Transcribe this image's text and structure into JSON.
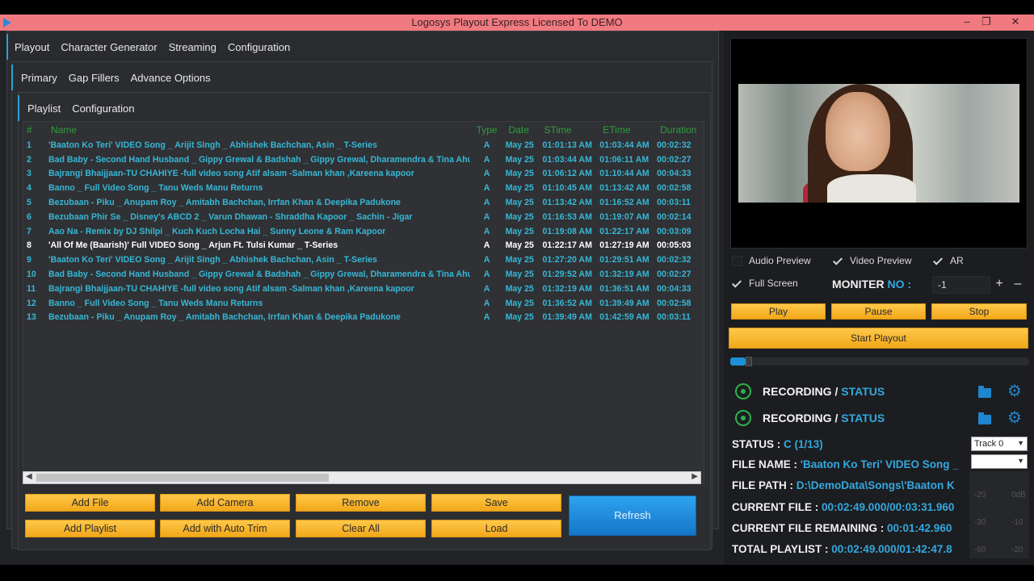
{
  "window": {
    "title": "Logosys Playout Express Licensed To DEMO",
    "controls": [
      "–",
      "❐",
      "✕"
    ]
  },
  "tabs_main": [
    "Playout",
    "Character Generator",
    "Streaming",
    "Configuration"
  ],
  "tabs_sub": [
    "Primary",
    "Gap Fillers",
    "Advance Options"
  ],
  "tabs_playlist": [
    "Playlist",
    "Configuration"
  ],
  "playlist": {
    "columns": [
      "#",
      "Name",
      "Type",
      "Date",
      "STime",
      "ETime",
      "Duration"
    ],
    "current_index": 8,
    "rows": [
      {
        "num": "1",
        "name": "'Baaton Ko Teri' VIDEO Song _ Arijit Singh _ Abhishek Bachchan, Asin _ T-Series",
        "type": "A",
        "date": "May 25",
        "stime": "01:01:13 AM",
        "etime": "01:03:44 AM",
        "duration": "00:02:32"
      },
      {
        "num": "2",
        "name": "Bad Baby - Second Hand Husband _ Gippy Grewal & Badshah _ Gippy Grewal, Dharamendra & Tina Ahuja",
        "type": "A",
        "date": "May 25",
        "stime": "01:03:44 AM",
        "etime": "01:06:11 AM",
        "duration": "00:02:27"
      },
      {
        "num": "3",
        "name": "Bajrangi Bhaijjaan-TU CHAHIYE -full video song Atif alsam -Salman khan ,Kareena kapoor",
        "type": "A",
        "date": "May 25",
        "stime": "01:06:12 AM",
        "etime": "01:10:44 AM",
        "duration": "00:04:33"
      },
      {
        "num": "4",
        "name": "Banno _ Full Video Song _ Tanu Weds Manu Returns",
        "type": "A",
        "date": "May 25",
        "stime": "01:10:45 AM",
        "etime": "01:13:42 AM",
        "duration": "00:02:58"
      },
      {
        "num": "5",
        "name": "Bezubaan - Piku _ Anupam Roy _ Amitabh Bachchan, Irrfan Khan & Deepika Padukone",
        "type": "A",
        "date": "May 25",
        "stime": "01:13:42 AM",
        "etime": "01:16:52 AM",
        "duration": "00:03:11"
      },
      {
        "num": "6",
        "name": "Bezubaan Phir Se _ Disney's ABCD 2 _ Varun Dhawan - Shraddha Kapoor _ Sachin - Jigar",
        "type": "A",
        "date": "May 25",
        "stime": "01:16:53 AM",
        "etime": "01:19:07 AM",
        "duration": "00:02:14"
      },
      {
        "num": "7",
        "name": "Aao Na - Remix by DJ Shilpi _ Kuch Kuch Locha Hai _ Sunny Leone & Ram Kapoor",
        "type": "A",
        "date": "May 25",
        "stime": "01:19:08 AM",
        "etime": "01:22:17 AM",
        "duration": "00:03:09"
      },
      {
        "num": "8",
        "name": "'All Of Me (Baarish)' Full VIDEO Song _ Arjun Ft. Tulsi Kumar _ T-Series",
        "type": "A",
        "date": "May 25",
        "stime": "01:22:17 AM",
        "etime": "01:27:19 AM",
        "duration": "00:05:03"
      },
      {
        "num": "9",
        "name": "'Baaton Ko Teri' VIDEO Song _ Arijit Singh _ Abhishek Bachchan, Asin _ T-Series",
        "type": "A",
        "date": "May 25",
        "stime": "01:27:20 AM",
        "etime": "01:29:51 AM",
        "duration": "00:02:32"
      },
      {
        "num": "10",
        "name": "Bad Baby - Second Hand Husband _ Gippy Grewal & Badshah _ Gippy Grewal, Dharamendra & Tina Ahuja",
        "type": "A",
        "date": "May 25",
        "stime": "01:29:52 AM",
        "etime": "01:32:19 AM",
        "duration": "00:02:27"
      },
      {
        "num": "11",
        "name": "Bajrangi Bhaijjaan-TU CHAHIYE -full video song Atif alsam -Salman khan ,Kareena kapoor",
        "type": "A",
        "date": "May 25",
        "stime": "01:32:19 AM",
        "etime": "01:36:51 AM",
        "duration": "00:04:33"
      },
      {
        "num": "12",
        "name": "Banno _ Full Video Song _ Tanu Weds Manu Returns",
        "type": "A",
        "date": "May 25",
        "stime": "01:36:52 AM",
        "etime": "01:39:49 AM",
        "duration": "00:02:58"
      },
      {
        "num": "13",
        "name": "Bezubaan - Piku _ Anupam Roy _ Amitabh Bachchan, Irrfan Khan & Deepika Padukone",
        "type": "A",
        "date": "May 25",
        "stime": "01:39:49 AM",
        "etime": "01:42:59 AM",
        "duration": "00:03:11"
      }
    ]
  },
  "buttons": {
    "add_file": "Add File",
    "add_camera": "Add Camera",
    "remove": "Remove",
    "save": "Save",
    "add_playlist": "Add Playlist",
    "add_auto_trim": "Add with Auto Trim",
    "clear_all": "Clear All",
    "load": "Load",
    "refresh": "Refresh",
    "play": "Play",
    "pause": "Pause",
    "stop": "Stop",
    "start_playout": "Start Playout"
  },
  "preview": {
    "audio_preview": "Audio Preview",
    "video_preview": "Video Preview",
    "ar": "AR",
    "full_screen": "Full Screen",
    "moniter_label": "MONITER",
    "moniter_no": "NO :",
    "moniter_value": "-1",
    "plus": "+",
    "minus": "–",
    "progress": 0.05
  },
  "recording": [
    {
      "label": "RECORDING /",
      "status": "STATUS"
    },
    {
      "label": "RECORDING /",
      "status": "STATUS"
    }
  ],
  "status": {
    "status_label": "STATUS :",
    "status_value": "C (1/13)",
    "file_name_label": "FILE NAME :",
    "file_name_value": "'Baaton Ko Teri' VIDEO Song _",
    "file_path_label": "FILE PATH :",
    "file_path_value": "D:\\DemoData\\Songs\\'Baaton K",
    "current_file_label": "CURRENT FILE :",
    "current_file_value": "00:02:49.000/00:03:31.960",
    "remaining_label": "CURRENT FILE REMAINING :",
    "remaining_value": "00:01:42.960",
    "total_label": "TOTAL PLAYLIST :",
    "total_value": "00:02:49.000/01:42:47.8"
  },
  "track_select": "Track 0",
  "meter_labels": [
    "-20",
    "0dB",
    "-30",
    "-10",
    "-60",
    "-20"
  ],
  "colors": {
    "accent_blue": "#33a8de",
    "button_yellow": "#f5b025",
    "title_bar": "#f07a80",
    "header_green": "#2d9e3e"
  }
}
